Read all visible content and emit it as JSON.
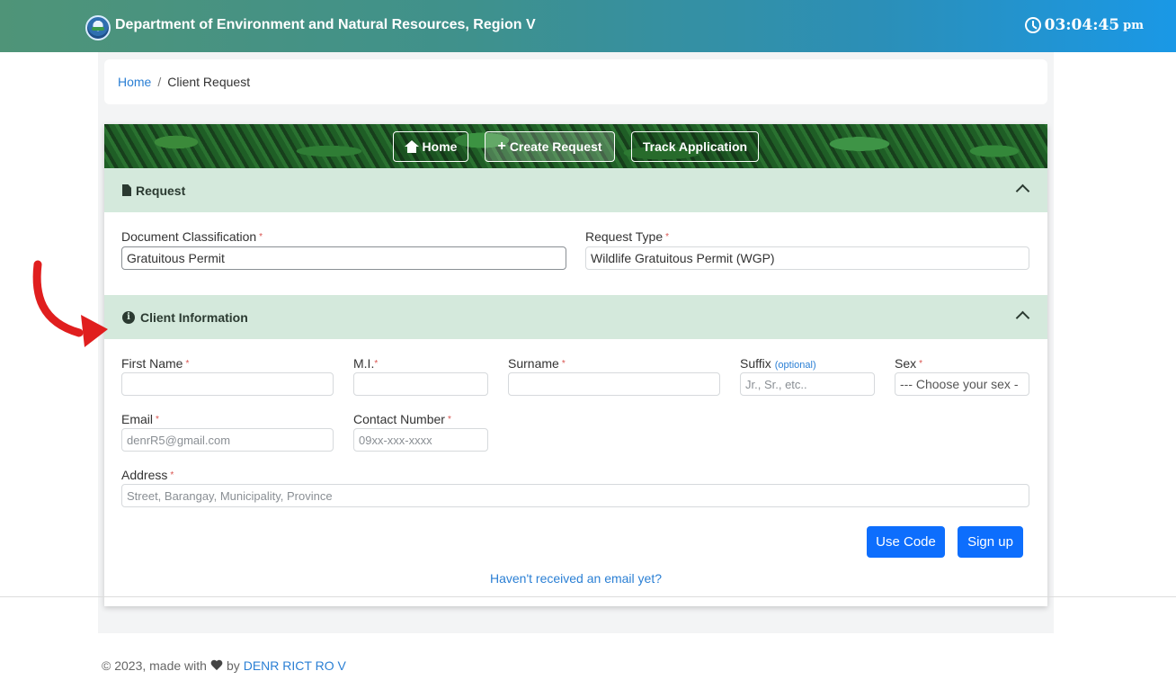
{
  "header": {
    "title": "Department of Environment and Natural Resources, Region V",
    "time": "03:04:45",
    "ampm": "pm"
  },
  "breadcrumb": {
    "home": "Home",
    "separator": "/",
    "current": "Client Request"
  },
  "nav": {
    "home": "Home",
    "create": "Create Request",
    "track": "Track Application"
  },
  "request_section": {
    "title": "Request",
    "doc_class_label": "Document Classification",
    "doc_class_value": "Gratuitous Permit",
    "req_type_label": "Request Type",
    "req_type_value": "Wildlife Gratuitous Permit (WGP)"
  },
  "client_section": {
    "title": "Client Information",
    "first_name_label": "First Name",
    "mi_label": "M.I.",
    "surname_label": "Surname",
    "suffix_label": "Suffix",
    "suffix_optional": "(optional)",
    "suffix_placeholder": "Jr., Sr., etc..",
    "sex_label": "Sex",
    "sex_selected": "--- Choose your sex -",
    "email_label": "Email",
    "email_placeholder": "denrR5@gmail.com",
    "contact_label": "Contact Number",
    "contact_placeholder": "09xx-xxx-xxxx",
    "address_label": "Address",
    "address_placeholder": "Street, Barangay, Municipality, Province",
    "required_mark": "*"
  },
  "actions": {
    "use_code": "Use Code",
    "sign_up": "Sign up",
    "resend_link": "Haven't received an email yet?"
  },
  "footer": {
    "text": "© 2023, made with",
    "by": "by",
    "link": "DENR RICT RO V"
  },
  "colors": {
    "accent": "#0d6efd",
    "section_header": "#d4e9dc",
    "annotation_arrow": "#e01e1e"
  }
}
